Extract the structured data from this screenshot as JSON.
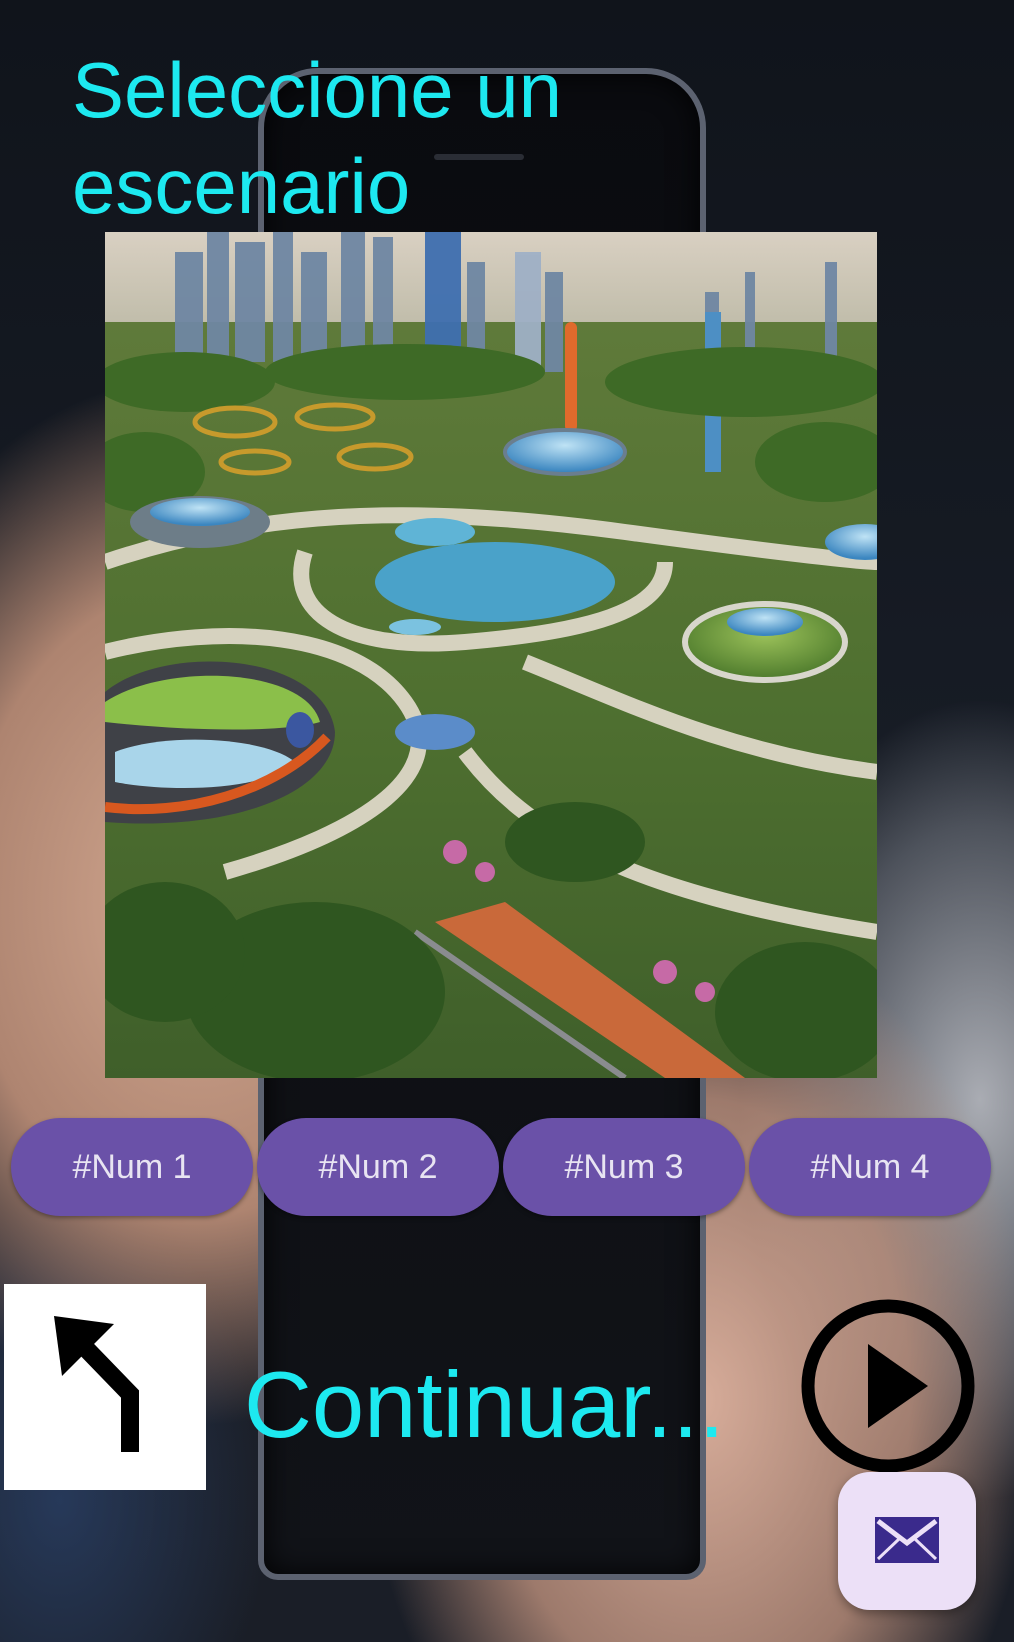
{
  "screen": {
    "title": "Seleccione un escenario",
    "scene_image": "futuristic-city-park-image"
  },
  "options": [
    {
      "label": "#Num 1"
    },
    {
      "label": "#Num 2"
    },
    {
      "label": "#Num 3"
    },
    {
      "label": "#Num 4"
    }
  ],
  "footer": {
    "back_icon": "turn-left-arrow-icon",
    "continue_label": "Continuar...",
    "play_icon": "play-circle-icon",
    "mail_icon": "envelope-icon"
  },
  "colors": {
    "title": "#1de9f0",
    "chip": "#6a51a8",
    "fab": "#ece0f7",
    "fab_icon": "#3a2a8c"
  }
}
